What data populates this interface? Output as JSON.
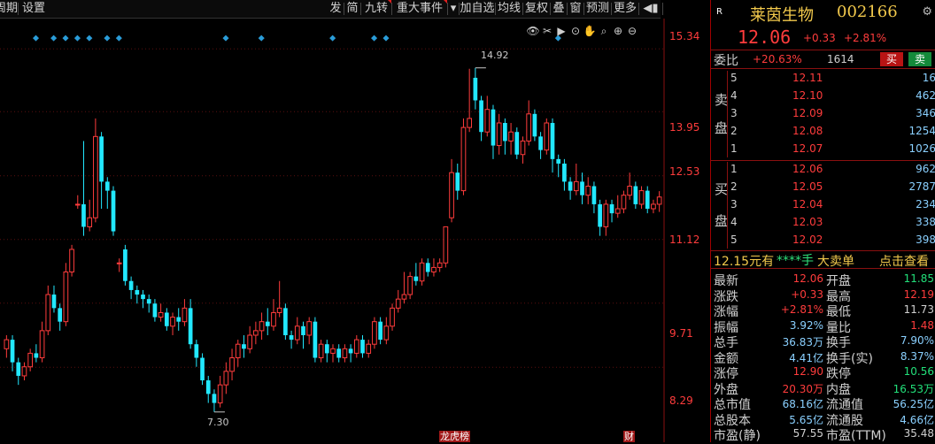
{
  "toolbar": {
    "left_items": [
      "周期",
      "设置"
    ],
    "right_items": [
      {
        "label": "发",
        "flag": false
      },
      {
        "label": "简",
        "flag": false
      },
      {
        "label": "九转",
        "flag": true
      },
      {
        "label": "重大事件",
        "flag": true
      },
      {
        "label": "▾",
        "flag": false
      },
      {
        "label": "加自选",
        "flag": false
      },
      {
        "label": "均线",
        "flag": false
      },
      {
        "label": "复权",
        "flag": false
      },
      {
        "label": "叠",
        "flag": false
      },
      {
        "label": "窗",
        "flag": false
      },
      {
        "label": "预测",
        "flag": false
      },
      {
        "label": "更多",
        "flag": false
      },
      {
        "label": "◀▮",
        "flag": false
      }
    ]
  },
  "chart": {
    "price_axis": [
      "15.34",
      "13.95",
      "12.53",
      "11.12",
      "9.71",
      "8.29"
    ],
    "high_label": "14.92",
    "low_label": "7.30",
    "date_tags": [
      "龙虎榜",
      "财"
    ],
    "tools": [
      "eye-icon",
      "scissors-icon",
      "play-icon",
      "camera-icon",
      "hand-icon",
      "magnify-icon",
      "zoom-in-icon",
      "zoom-out-icon"
    ],
    "tool_glyphs": [
      "👁",
      "✂",
      "▶",
      "⊙",
      "✋",
      "⌕",
      "⊕",
      "⊖"
    ],
    "colors": {
      "up": "#ff3c3c",
      "down": "#22e8ff",
      "grid": "#5a0f0f",
      "marker": "#2a9cd8"
    }
  },
  "chart_data": {
    "type": "candlestick",
    "y_axis_ticks": [
      15.34,
      13.95,
      12.53,
      11.12,
      9.71,
      8.29
    ],
    "ylim": [
      7.1,
      15.6
    ],
    "marked_high": 14.92,
    "marked_low": 7.3,
    "marker_candle_indices": [
      5,
      8,
      10,
      12,
      14,
      17,
      19,
      37,
      43,
      55,
      62,
      64,
      93
    ],
    "candles": [
      {
        "o": 8.7,
        "c": 8.9,
        "h": 9.0,
        "l": 8.5
      },
      {
        "o": 8.9,
        "c": 8.4,
        "h": 9.0,
        "l": 8.2
      },
      {
        "o": 8.4,
        "c": 8.1,
        "h": 8.5,
        "l": 7.9
      },
      {
        "o": 8.1,
        "c": 8.3,
        "h": 8.4,
        "l": 8.0
      },
      {
        "o": 8.3,
        "c": 8.6,
        "h": 8.7,
        "l": 8.2
      },
      {
        "o": 8.6,
        "c": 8.5,
        "h": 8.8,
        "l": 8.4
      },
      {
        "o": 8.5,
        "c": 9.1,
        "h": 9.3,
        "l": 8.4
      },
      {
        "o": 9.1,
        "c": 9.9,
        "h": 10.1,
        "l": 9.0
      },
      {
        "o": 9.9,
        "c": 9.6,
        "h": 10.1,
        "l": 9.5
      },
      {
        "o": 9.6,
        "c": 9.3,
        "h": 9.7,
        "l": 9.1
      },
      {
        "o": 9.3,
        "c": 10.4,
        "h": 10.6,
        "l": 9.2
      },
      {
        "o": 10.4,
        "c": 10.9,
        "h": 11.0,
        "l": 10.3
      },
      {
        "o": 11.9,
        "c": 11.9,
        "h": 12.1,
        "l": 11.8
      },
      {
        "o": 11.9,
        "c": 11.4,
        "h": 13.3,
        "l": 11.2
      },
      {
        "o": 11.4,
        "c": 11.6,
        "h": 12.0,
        "l": 11.3
      },
      {
        "o": 11.6,
        "c": 13.4,
        "h": 13.8,
        "l": 11.5
      },
      {
        "o": 13.4,
        "c": 12.4,
        "h": 13.5,
        "l": 11.8
      },
      {
        "o": 12.4,
        "c": 12.2,
        "h": 12.5,
        "l": 11.8
      },
      {
        "o": 12.2,
        "c": 11.3,
        "h": 12.3,
        "l": 11.2
      },
      {
        "o": 10.6,
        "c": 10.6,
        "h": 10.7,
        "l": 10.4
      },
      {
        "o": 10.9,
        "c": 10.2,
        "h": 11.0,
        "l": 10.1
      },
      {
        "o": 10.2,
        "c": 10.0,
        "h": 10.3,
        "l": 9.8
      },
      {
        "o": 10.0,
        "c": 9.9,
        "h": 10.1,
        "l": 9.7
      },
      {
        "o": 9.9,
        "c": 9.8,
        "h": 10.0,
        "l": 9.6
      },
      {
        "o": 9.8,
        "c": 9.7,
        "h": 9.9,
        "l": 9.5
      },
      {
        "o": 9.7,
        "c": 9.4,
        "h": 9.8,
        "l": 9.3
      },
      {
        "o": 9.4,
        "c": 9.5,
        "h": 9.7,
        "l": 9.3
      },
      {
        "o": 9.5,
        "c": 9.2,
        "h": 9.6,
        "l": 9.1
      },
      {
        "o": 9.2,
        "c": 9.4,
        "h": 9.5,
        "l": 9.0
      },
      {
        "o": 9.4,
        "c": 9.3,
        "h": 9.6,
        "l": 9.1
      },
      {
        "o": 9.3,
        "c": 9.6,
        "h": 9.8,
        "l": 9.2
      },
      {
        "o": 9.6,
        "c": 8.8,
        "h": 9.8,
        "l": 8.7
      },
      {
        "o": 8.8,
        "c": 8.5,
        "h": 8.9,
        "l": 8.3
      },
      {
        "o": 8.5,
        "c": 8.0,
        "h": 8.6,
        "l": 7.9
      },
      {
        "o": 8.0,
        "c": 7.7,
        "h": 8.1,
        "l": 7.5
      },
      {
        "o": 7.7,
        "c": 7.5,
        "h": 7.8,
        "l": 7.3
      },
      {
        "o": 7.5,
        "c": 7.9,
        "h": 8.1,
        "l": 7.4
      },
      {
        "o": 7.9,
        "c": 8.2,
        "h": 8.4,
        "l": 7.7
      },
      {
        "o": 8.2,
        "c": 8.5,
        "h": 8.7,
        "l": 8.0
      },
      {
        "o": 8.5,
        "c": 8.8,
        "h": 8.9,
        "l": 8.3
      },
      {
        "o": 8.8,
        "c": 8.7,
        "h": 9.0,
        "l": 8.5
      },
      {
        "o": 8.7,
        "c": 9.0,
        "h": 9.2,
        "l": 8.6
      },
      {
        "o": 9.0,
        "c": 9.1,
        "h": 9.3,
        "l": 8.8
      },
      {
        "o": 9.1,
        "c": 9.3,
        "h": 9.5,
        "l": 8.9
      },
      {
        "o": 9.3,
        "c": 9.2,
        "h": 9.6,
        "l": 9.0
      },
      {
        "o": 9.2,
        "c": 9.5,
        "h": 9.8,
        "l": 9.1
      },
      {
        "o": 9.5,
        "c": 9.6,
        "h": 10.2,
        "l": 9.4
      },
      {
        "o": 9.6,
        "c": 9.0,
        "h": 9.7,
        "l": 8.9
      },
      {
        "o": 9.0,
        "c": 8.9,
        "h": 9.1,
        "l": 8.7
      },
      {
        "o": 8.9,
        "c": 9.2,
        "h": 9.4,
        "l": 8.8
      },
      {
        "o": 9.2,
        "c": 9.0,
        "h": 9.3,
        "l": 8.7
      },
      {
        "o": 9.0,
        "c": 9.3,
        "h": 9.4,
        "l": 8.8
      },
      {
        "o": 9.3,
        "c": 8.5,
        "h": 9.4,
        "l": 8.4
      },
      {
        "o": 8.5,
        "c": 8.8,
        "h": 8.9,
        "l": 8.4
      },
      {
        "o": 8.8,
        "c": 8.6,
        "h": 8.9,
        "l": 8.4
      },
      {
        "o": 8.6,
        "c": 8.7,
        "h": 8.8,
        "l": 8.4
      },
      {
        "o": 8.7,
        "c": 8.5,
        "h": 8.8,
        "l": 8.4
      },
      {
        "o": 8.5,
        "c": 8.7,
        "h": 8.8,
        "l": 8.4
      },
      {
        "o": 8.7,
        "c": 8.6,
        "h": 8.8,
        "l": 8.4
      },
      {
        "o": 8.6,
        "c": 8.9,
        "h": 9.0,
        "l": 8.5
      },
      {
        "o": 8.9,
        "c": 8.6,
        "h": 9.0,
        "l": 8.5
      },
      {
        "o": 8.6,
        "c": 8.8,
        "h": 8.9,
        "l": 8.5
      },
      {
        "o": 8.8,
        "c": 9.3,
        "h": 9.4,
        "l": 8.7
      },
      {
        "o": 9.3,
        "c": 8.9,
        "h": 9.4,
        "l": 8.8
      },
      {
        "o": 8.9,
        "c": 9.2,
        "h": 9.4,
        "l": 8.8
      },
      {
        "o": 9.2,
        "c": 9.6,
        "h": 9.7,
        "l": 9.1
      },
      {
        "o": 9.6,
        "c": 9.8,
        "h": 10.0,
        "l": 9.5
      },
      {
        "o": 9.8,
        "c": 9.9,
        "h": 10.4,
        "l": 9.7
      },
      {
        "o": 9.9,
        "c": 10.3,
        "h": 10.4,
        "l": 9.8
      },
      {
        "o": 10.3,
        "c": 10.2,
        "h": 10.6,
        "l": 10.1
      },
      {
        "o": 10.2,
        "c": 10.6,
        "h": 10.7,
        "l": 10.1
      },
      {
        "o": 10.6,
        "c": 10.4,
        "h": 10.7,
        "l": 10.3
      },
      {
        "o": 10.4,
        "c": 10.5,
        "h": 10.7,
        "l": 10.3
      },
      {
        "o": 10.5,
        "c": 10.6,
        "h": 10.7,
        "l": 10.4
      },
      {
        "o": 10.6,
        "c": 11.4,
        "h": 11.4,
        "l": 10.5
      },
      {
        "o": 11.6,
        "c": 12.6,
        "h": 12.9,
        "l": 11.5
      },
      {
        "o": 12.6,
        "c": 12.2,
        "h": 12.8,
        "l": 12.0
      },
      {
        "o": 12.2,
        "c": 13.6,
        "h": 13.8,
        "l": 12.1
      },
      {
        "o": 13.6,
        "c": 13.8,
        "h": 14.9,
        "l": 13.5
      },
      {
        "o": 14.7,
        "c": 14.2,
        "h": 14.92,
        "l": 14.0
      },
      {
        "o": 14.2,
        "c": 13.5,
        "h": 14.3,
        "l": 13.3
      },
      {
        "o": 13.5,
        "c": 14.0,
        "h": 14.3,
        "l": 13.4
      },
      {
        "o": 14.0,
        "c": 13.2,
        "h": 14.1,
        "l": 12.9
      },
      {
        "o": 13.2,
        "c": 13.7,
        "h": 13.9,
        "l": 13.0
      },
      {
        "o": 13.7,
        "c": 13.3,
        "h": 13.8,
        "l": 13.0
      },
      {
        "o": 13.3,
        "c": 13.5,
        "h": 13.7,
        "l": 13.0
      },
      {
        "o": 13.5,
        "c": 13.0,
        "h": 13.6,
        "l": 12.9
      },
      {
        "o": 13.0,
        "c": 13.3,
        "h": 13.4,
        "l": 12.8
      },
      {
        "o": 13.3,
        "c": 13.9,
        "h": 14.2,
        "l": 13.2
      },
      {
        "o": 13.9,
        "c": 13.4,
        "h": 14.0,
        "l": 13.3
      },
      {
        "o": 13.4,
        "c": 13.1,
        "h": 13.5,
        "l": 12.9
      },
      {
        "o": 13.1,
        "c": 13.7,
        "h": 13.8,
        "l": 13.0
      },
      {
        "o": 13.7,
        "c": 12.9,
        "h": 13.8,
        "l": 12.6
      },
      {
        "o": 12.9,
        "c": 12.8,
        "h": 13.0,
        "l": 12.5
      },
      {
        "o": 12.8,
        "c": 12.4,
        "h": 12.9,
        "l": 12.2
      },
      {
        "o": 12.4,
        "c": 12.2,
        "h": 12.5,
        "l": 12.0
      },
      {
        "o": 12.2,
        "c": 12.4,
        "h": 12.8,
        "l": 12.1
      },
      {
        "o": 12.4,
        "c": 12.1,
        "h": 12.6,
        "l": 11.9
      },
      {
        "o": 12.1,
        "c": 12.3,
        "h": 12.5,
        "l": 11.9
      },
      {
        "o": 12.3,
        "c": 11.9,
        "h": 12.4,
        "l": 11.7
      },
      {
        "o": 11.9,
        "c": 11.4,
        "h": 12.0,
        "l": 11.2
      },
      {
        "o": 11.4,
        "c": 11.9,
        "h": 12.0,
        "l": 11.2
      },
      {
        "o": 11.9,
        "c": 11.7,
        "h": 12.0,
        "l": 11.5
      },
      {
        "o": 11.7,
        "c": 11.8,
        "h": 12.1,
        "l": 11.6
      },
      {
        "o": 11.8,
        "c": 12.1,
        "h": 12.2,
        "l": 11.7
      },
      {
        "o": 12.1,
        "c": 12.3,
        "h": 12.6,
        "l": 12.0
      },
      {
        "o": 12.3,
        "c": 11.9,
        "h": 12.4,
        "l": 11.8
      },
      {
        "o": 11.9,
        "c": 12.2,
        "h": 12.3,
        "l": 11.8
      },
      {
        "o": 12.2,
        "c": 11.8,
        "h": 12.3,
        "l": 11.7
      },
      {
        "o": 11.8,
        "c": 11.9,
        "h": 12.0,
        "l": 11.7
      },
      {
        "o": 11.9,
        "c": 12.06,
        "h": 12.19,
        "l": 11.73
      }
    ]
  },
  "quote": {
    "r_tag": "R",
    "name": "莱茵生物",
    "code": "002166",
    "price": "12.06",
    "change": "+0.33",
    "change_pct": "+2.81%",
    "settings_glyph": "⚙",
    "weibi_label": "委比",
    "weibi_value": "+20.63%",
    "weibi_diff": "1614",
    "buy_label": "买",
    "sell_label": "卖"
  },
  "order_book": {
    "sell_label": [
      "卖",
      "盘"
    ],
    "buy_label": [
      "买",
      "盘"
    ],
    "asks": [
      {
        "level": "5",
        "price": "12.11",
        "vol": "16"
      },
      {
        "level": "4",
        "price": "12.10",
        "vol": "462"
      },
      {
        "level": "3",
        "price": "12.09",
        "vol": "346"
      },
      {
        "level": "2",
        "price": "12.08",
        "vol": "1254"
      },
      {
        "level": "1",
        "price": "12.07",
        "vol": "1026"
      }
    ],
    "bids": [
      {
        "level": "1",
        "price": "12.06",
        "vol": "962"
      },
      {
        "level": "2",
        "price": "12.05",
        "vol": "2787"
      },
      {
        "level": "3",
        "price": "12.04",
        "vol": "234"
      },
      {
        "level": "4",
        "price": "12.03",
        "vol": "338"
      },
      {
        "level": "5",
        "price": "12.02",
        "vol": "398"
      }
    ]
  },
  "big_order": {
    "text": "12.15元有",
    "hand": "****手",
    "label": "大卖单",
    "link": "点击查看"
  },
  "stats": [
    {
      "k1": "最新",
      "v1": "12.06",
      "c1": "#ff3c3c",
      "k2": "开盘",
      "v2": "11.85",
      "c2": "#22e07a"
    },
    {
      "k1": "涨跌",
      "v1": "+0.33",
      "c1": "#ff3c3c",
      "k2": "最高",
      "v2": "12.19",
      "c2": "#ff3c3c"
    },
    {
      "k1": "涨幅",
      "v1": "+2.81%",
      "c1": "#ff3c3c",
      "k2": "最低",
      "v2": "11.73",
      "c2": "#d0d0d0"
    },
    {
      "k1": "振幅",
      "v1": "3.92%",
      "c1": "#8ad0ff",
      "k2": "量比",
      "v2": "1.48",
      "c2": "#ff3c3c"
    },
    {
      "k1": "总手",
      "v1": "36.83万",
      "c1": "#8ad0ff",
      "k2": "换手",
      "v2": "7.90%",
      "c2": "#8ad0ff"
    },
    {
      "k1": "金额",
      "v1": "4.41亿",
      "c1": "#8ad0ff",
      "k2": "换手(实)",
      "v2": "8.37%",
      "c2": "#8ad0ff"
    },
    {
      "k1": "涨停",
      "v1": "12.90",
      "c1": "#ff3c3c",
      "k2": "跌停",
      "v2": "10.56",
      "c2": "#22e07a"
    },
    {
      "k1": "外盘",
      "v1": "20.30万",
      "c1": "#ff3c3c",
      "k2": "内盘",
      "v2": "16.53万",
      "c2": "#22e07a"
    },
    {
      "k1": "总市值",
      "v1": "68.16亿",
      "c1": "#8ad0ff",
      "k2": "流通值",
      "v2": "56.25亿",
      "c2": "#8ad0ff"
    },
    {
      "k1": "总股本",
      "v1": "5.65亿",
      "c1": "#8ad0ff",
      "k2": "流通股",
      "v2": "4.66亿",
      "c2": "#8ad0ff"
    },
    {
      "k1": "市盈(静)",
      "v1": "57.55",
      "c1": "#d0d0d0",
      "k2": "市盈(TTM)",
      "v2": "35.48",
      "c2": "#d0d0d0"
    }
  ]
}
